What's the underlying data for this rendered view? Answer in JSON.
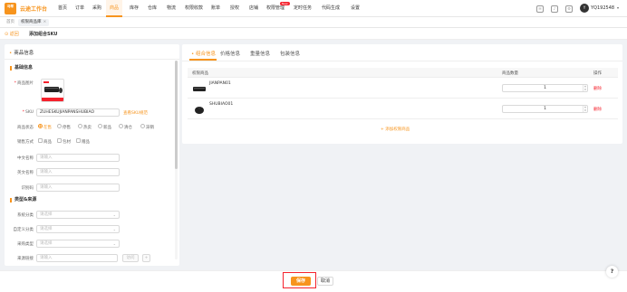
{
  "app": {
    "logo_icon_text": "马帮",
    "logo_text": "云途工作台"
  },
  "nav": {
    "items": [
      "首页",
      "订单",
      "采购",
      "商品",
      "库存",
      "仓库",
      "物流",
      "权限收款",
      "账单",
      "授权",
      "权限管理",
      "店铺",
      "促销商城",
      "定时任务",
      "代码生成",
      "设置"
    ],
    "active_index": 3,
    "new_badge": "New",
    "new_badge_index": 10
  },
  "user": {
    "id": "YQ192548",
    "avatar_text": "Y"
  },
  "tabs": {
    "home": "首页",
    "current": "权限商品库",
    "close": "×"
  },
  "page": {
    "back_label": "返回",
    "title": "添加组合SKU"
  },
  "left": {
    "panel_title": "商品信息",
    "section_basic": "基础信息",
    "image_label": "商品图片",
    "sku_label": "SKU",
    "sku_value": "ZUHESKUJIANPANSHUBIAO",
    "sku_link": "查看SKU规范",
    "status_label": "商品状态",
    "status_options": [
      "在售",
      "停售",
      "热卖",
      "新品",
      "清仓",
      "滞销"
    ],
    "status_checked_index": 0,
    "sales_label": "销售方式",
    "sales_options": [
      "商品",
      "包材",
      "赠品"
    ],
    "cn_name_label": "中文名称",
    "cn_name_placeholder": "请输入",
    "en_name_label": "英文名称",
    "en_name_placeholder": "请输入",
    "barcode_label": "识别码",
    "barcode_placeholder": "请输入",
    "section_type": "类型&来源",
    "sys_cat_label": "系统分类",
    "sys_cat_placeholder": "请选择",
    "custom_cat_label": "自定义分类",
    "custom_cat_placeholder": "请选择",
    "purchase_type_label": "采购类型",
    "purchase_type_placeholder": "请选择",
    "source_label": "来源链接",
    "source_placeholder": "请输入",
    "source_btn1": "访问",
    "source_btn2": "+"
  },
  "right": {
    "tabs": [
      "组合信息",
      "价格信息",
      "重量信息",
      "包装信息"
    ],
    "active_tab": 0,
    "col_sku": "权限商品",
    "col_qty": "商品数量",
    "col_action": "操作",
    "rows": [
      {
        "sku": "JIANPAN01",
        "qty": "1",
        "action": "删除",
        "icon": "keyboard-icon"
      },
      {
        "sku": "SHUBIAO01",
        "qty": "1",
        "action": "删除",
        "icon": "mouse-icon"
      }
    ],
    "add_link": "+ 添加权限商品"
  },
  "footer": {
    "save": "保存",
    "cancel": "取消",
    "help": "?"
  },
  "colors": {
    "accent": "#f7941d",
    "danger": "#f5222d"
  }
}
